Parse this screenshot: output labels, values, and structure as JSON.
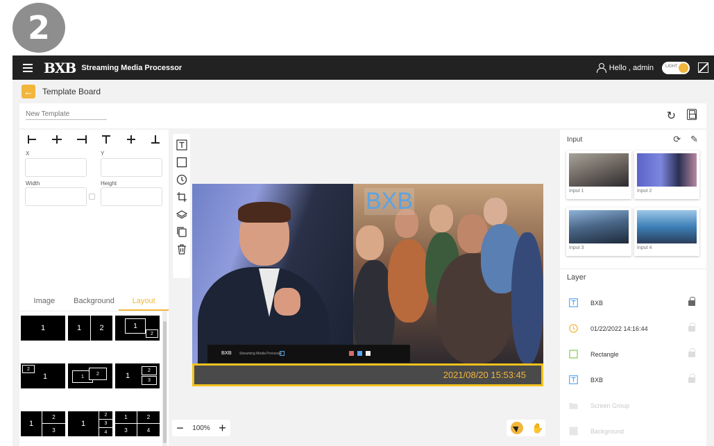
{
  "step_number": "2",
  "header": {
    "logo_text": "BXB",
    "app_title": "Streaming Media Processor",
    "greeting": "Hello , admin",
    "theme_toggle_label": "LIGHT"
  },
  "subbar": {
    "title": "Template Board"
  },
  "namebar": {
    "template_name_placeholder": "New Template"
  },
  "properties": {
    "x_label": "X",
    "y_label": "Y",
    "width_label": "Width",
    "height_label": "Height"
  },
  "asset_tabs": [
    {
      "label": "Image",
      "active": false
    },
    {
      "label": "Background",
      "active": false
    },
    {
      "label": "Layout",
      "active": true
    }
  ],
  "stage": {
    "text_overlay": "BXB",
    "timestamp": "2021/08/20 15:53:45",
    "device_brand": "BXB",
    "device_model": "Streaming Media Processor"
  },
  "zoom": {
    "level": "100%"
  },
  "inputs": {
    "title": "Input",
    "items": [
      {
        "label": "Input 1"
      },
      {
        "label": "Input 2"
      },
      {
        "label": "Input 3"
      },
      {
        "label": "Input 4"
      }
    ]
  },
  "layers": {
    "title": "Layer",
    "items": [
      {
        "name": "BXB",
        "icon": "text-icon",
        "locked": true,
        "enabled": true
      },
      {
        "name": "01/22/2022 14:16:44",
        "icon": "clock-icon",
        "locked": false,
        "enabled": true
      },
      {
        "name": "Rectangle",
        "icon": "rectangle-icon",
        "locked": false,
        "enabled": true
      },
      {
        "name": "BXB",
        "icon": "text-icon",
        "locked": false,
        "enabled": true
      },
      {
        "name": "Screen Group",
        "icon": "folder-icon",
        "locked": false,
        "enabled": false
      },
      {
        "name": "Background",
        "icon": "image-icon",
        "locked": false,
        "enabled": false
      }
    ]
  },
  "layout_presets": [
    [
      "1"
    ],
    [
      "1",
      "2"
    ],
    [
      "1",
      "2"
    ],
    [
      "2",
      "1"
    ],
    [
      "1",
      "2"
    ],
    [
      "1",
      "2",
      "3"
    ],
    [
      "1",
      "2",
      "3"
    ],
    [
      "1",
      "2",
      "3",
      "4"
    ],
    [
      "1",
      "2",
      "3",
      "4"
    ]
  ],
  "colors": {
    "accent": "#f2b63c",
    "topbar": "#222222",
    "overlay_text": "#5ea3e0",
    "frame": "#f2c21c"
  }
}
